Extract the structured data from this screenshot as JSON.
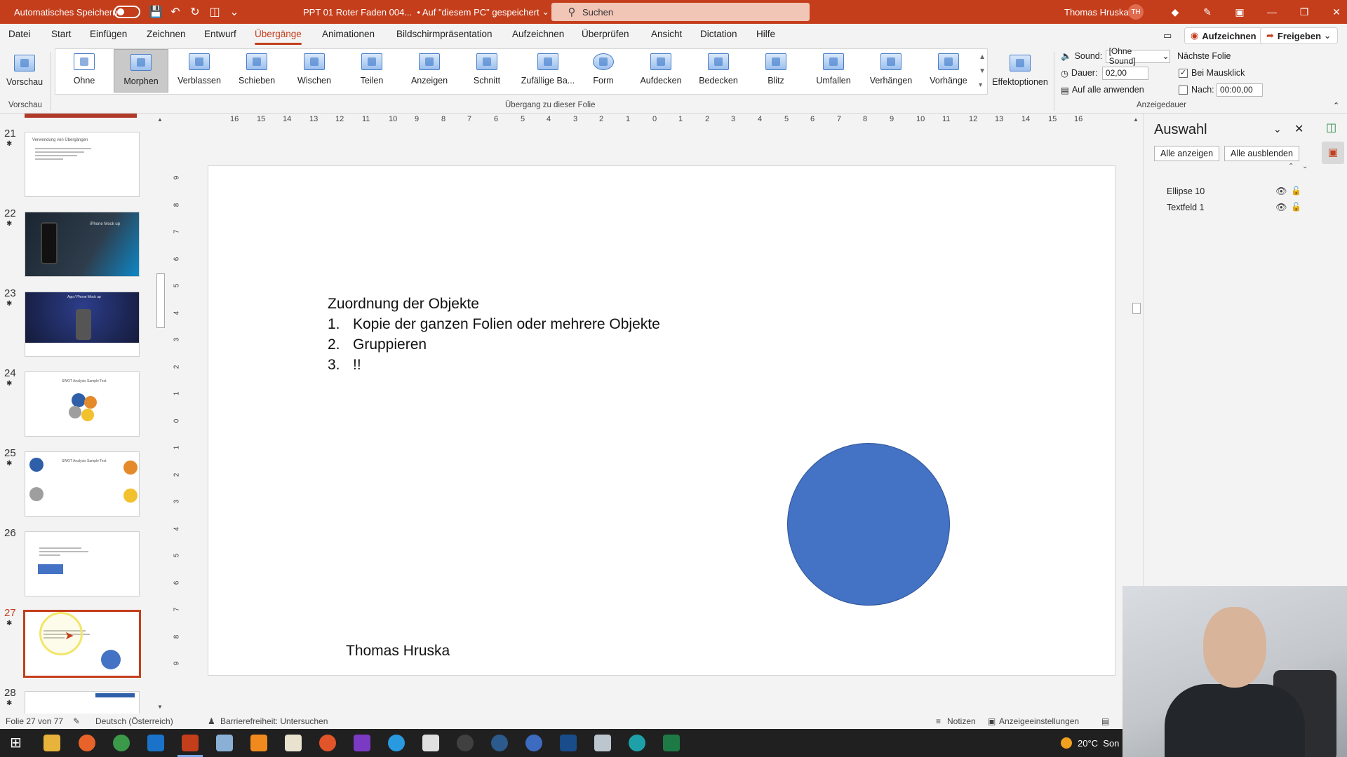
{
  "titlebar": {
    "autosave_label": "Automatisches Speichern",
    "doc_title": "PPT 01 Roter Faden 004...",
    "save_state": "• Auf \"diesem PC\" gespeichert",
    "search_placeholder": "Suchen",
    "user_name": "Thomas Hruska",
    "user_initials": "TH"
  },
  "menu": {
    "tabs": [
      "Datei",
      "Start",
      "Einfügen",
      "Zeichnen",
      "Entwurf",
      "Übergänge",
      "Animationen",
      "Bildschirmpräsentation",
      "Aufzeichnen",
      "Überprüfen",
      "Ansicht",
      "Dictation",
      "Hilfe"
    ],
    "active_tab": "Übergänge",
    "record_button": "Aufzeichnen",
    "share_button": "Freigeben"
  },
  "ribbon": {
    "preview_label": "Vorschau",
    "preview_group": "Vorschau",
    "transitions": [
      "Ohne",
      "Morphen",
      "Verblassen",
      "Schieben",
      "Wischen",
      "Teilen",
      "Anzeigen",
      "Schnitt",
      "Zufällige Ba...",
      "Form",
      "Aufdecken",
      "Bedecken",
      "Blitz",
      "Umfallen",
      "Verhängen",
      "Vorhänge"
    ],
    "selected_transition": "Morphen",
    "effect_options": "Effektoptionen",
    "transition_group": "Übergang zu dieser Folie",
    "sound_label": "Sound:",
    "sound_value": "[Ohne Sound]",
    "duration_label": "Dauer:",
    "duration_value": "02,00",
    "apply_all": "Auf alle anwenden",
    "next_slide_label": "Nächste Folie",
    "on_click_label": "Bei Mausklick",
    "after_label": "Nach:",
    "after_value": "00:00,00",
    "timing_group": "Anzeigedauer"
  },
  "thumbnails": {
    "slides": [
      {
        "num": "21",
        "title": "Verwendung von Übergängen"
      },
      {
        "num": "22",
        "title": "iPhone Mock up"
      },
      {
        "num": "23",
        "title": "App / Phone Mock up"
      },
      {
        "num": "24",
        "title": "SWOT Analysis Sample Text"
      },
      {
        "num": "25",
        "title": "SWOT Analysis Sample Text"
      },
      {
        "num": "26",
        "title": ""
      },
      {
        "num": "27",
        "title": ""
      },
      {
        "num": "28",
        "title": ""
      }
    ],
    "active_slide": "27"
  },
  "ruler": {
    "h_ticks": [
      "16",
      "15",
      "14",
      "13",
      "12",
      "11",
      "10",
      "9",
      "8",
      "7",
      "6",
      "5",
      "4",
      "3",
      "2",
      "1",
      "0",
      "1",
      "2",
      "3",
      "4",
      "5",
      "6",
      "7",
      "8",
      "9",
      "10",
      "11",
      "12",
      "13",
      "14",
      "15",
      "16"
    ],
    "v_ticks": [
      "9",
      "8",
      "7",
      "6",
      "5",
      "4",
      "3",
      "2",
      "1",
      "0",
      "1",
      "2",
      "3",
      "4",
      "5",
      "6",
      "7",
      "8",
      "9"
    ]
  },
  "slide": {
    "heading": "Zuordnung  der Objekte",
    "items": [
      {
        "num": "1.",
        "text": "Kopie der ganzen Folien oder mehrere Objekte"
      },
      {
        "num": "2.",
        "text": "Gruppieren"
      },
      {
        "num": "3.",
        "text": "!!"
      }
    ],
    "author": "Thomas Hruska",
    "ellipse_color": "#4472c4"
  },
  "selection_pane": {
    "title": "Auswahl",
    "show_all": "Alle anzeigen",
    "hide_all": "Alle ausblenden",
    "items": [
      "Ellipse 10",
      "Textfeld 1"
    ]
  },
  "statusbar": {
    "slide_info": "Folie 27 von 77",
    "language": "Deutsch (Österreich)",
    "accessibility": "Barrierefreiheit: Untersuchen",
    "notes": "Notizen",
    "display_settings": "Anzeigeeinstellungen"
  },
  "taskbar": {
    "temperature": "20°C",
    "weather_text": "Son"
  },
  "colors": {
    "accent": "#c43e1c",
    "ellipse": "#4472c4"
  }
}
